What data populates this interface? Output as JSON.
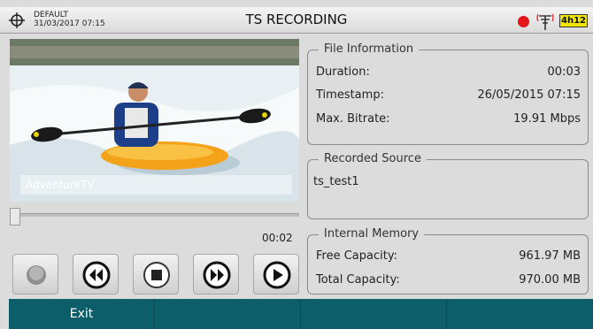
{
  "header": {
    "profile_name": "DEFAULT",
    "datetime": "31/03/2017 07:15",
    "title": "TS RECORDING",
    "battery": "4h12",
    "icons": [
      "crosshair-icon",
      "record-indicator-icon",
      "antenna-icon",
      "battery-icon"
    ]
  },
  "video": {
    "channel_label": "AdventureTV",
    "elapsed": "00:02",
    "progress_percent": 0
  },
  "controls": {
    "buttons": [
      "record-button",
      "rewind-button",
      "stop-button",
      "fast-forward-button",
      "play-button"
    ]
  },
  "file_information": {
    "legend": "File Information",
    "rows": [
      {
        "label": "Duration:",
        "value": "00:03"
      },
      {
        "label": "Timestamp:",
        "value": "26/05/2015 07:15"
      },
      {
        "label": "Max. Bitrate:",
        "value": "19.91 Mbps"
      }
    ]
  },
  "recorded_source": {
    "legend": "Recorded Source",
    "value": "ts_test1"
  },
  "internal_memory": {
    "legend": "Internal Memory",
    "rows": [
      {
        "label": "Free Capacity:",
        "value": "961.97 MB"
      },
      {
        "label": "Total Capacity:",
        "value": "970.00 MB"
      }
    ]
  },
  "softkeys": [
    "Exit",
    "",
    "",
    ""
  ],
  "colors": {
    "softkey_bar": "#0c5e6a",
    "record_dot": "#e4161c",
    "battery": "#f1e600"
  }
}
